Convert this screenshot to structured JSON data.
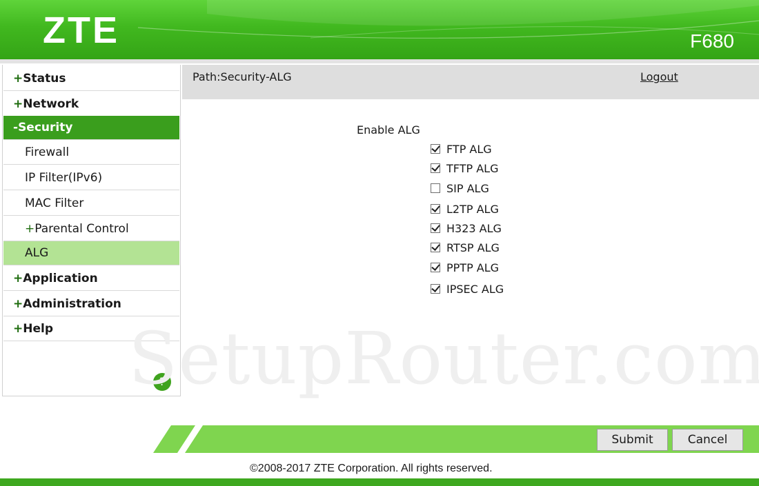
{
  "header": {
    "brand": "ZTE",
    "model": "F680"
  },
  "sidebar": {
    "items": [
      {
        "prefix": "+",
        "label": "Status"
      },
      {
        "prefix": "+",
        "label": "Network"
      },
      {
        "prefix": "-",
        "label": "Security"
      },
      {
        "label": "Firewall"
      },
      {
        "label": "IP Filter(IPv6)"
      },
      {
        "label": "MAC Filter"
      },
      {
        "prefix": "+",
        "label": "Parental Control"
      },
      {
        "label": "ALG"
      },
      {
        "prefix": "+",
        "label": "Application"
      },
      {
        "prefix": "+",
        "label": "Administration"
      },
      {
        "prefix": "+",
        "label": "Help"
      }
    ],
    "help_glyph": "?"
  },
  "path": {
    "text": "Path:Security-ALG",
    "logout": "Logout"
  },
  "form": {
    "title": "Enable ALG",
    "options": [
      {
        "label": "FTP ALG",
        "checked": true
      },
      {
        "label": "TFTP ALG",
        "checked": true
      },
      {
        "label": "SIP ALG",
        "checked": false
      },
      {
        "label": "L2TP ALG",
        "checked": true
      },
      {
        "label": "H323 ALG",
        "checked": true
      },
      {
        "label": "RTSP ALG",
        "checked": true
      },
      {
        "label": "PPTP ALG",
        "checked": true
      },
      {
        "label": "IPSEC ALG",
        "checked": true
      }
    ]
  },
  "watermark": "SetupRouter.com",
  "buttons": {
    "submit": "Submit",
    "cancel": "Cancel"
  },
  "footer": {
    "copyright": "©2008-2017 ZTE Corporation. All rights reserved."
  },
  "colors": {
    "brand_green": "#3a9e1d",
    "active_sub": "#b3e394",
    "bar_green": "#7fd54f"
  }
}
